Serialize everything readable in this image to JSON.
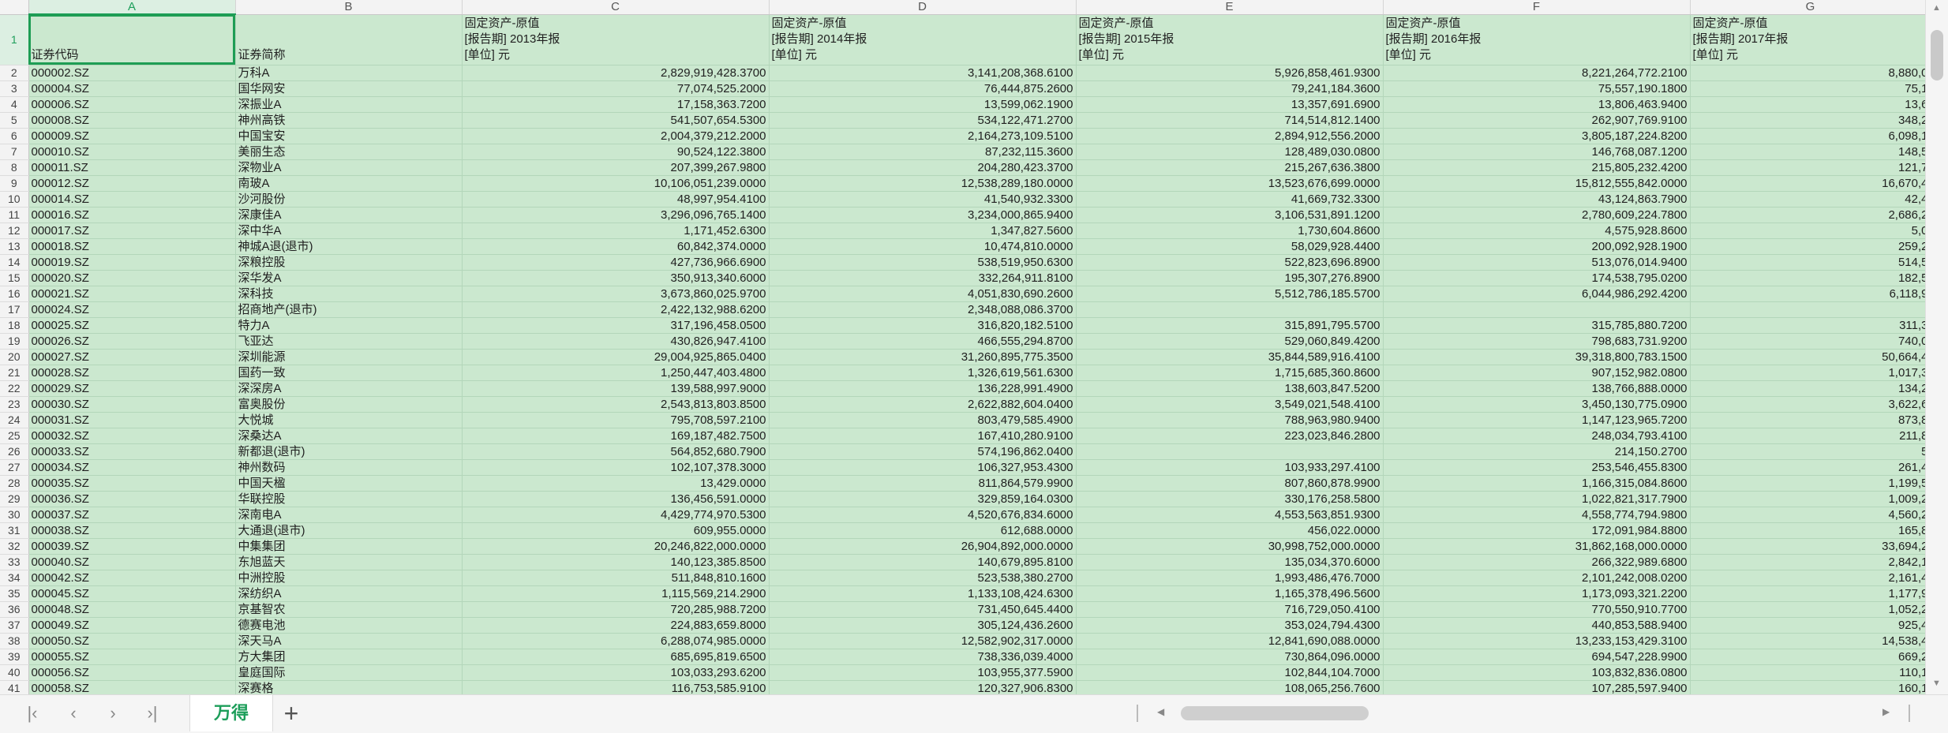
{
  "columns": [
    "A",
    "B",
    "C",
    "D",
    "E",
    "F",
    "G"
  ],
  "header_row": {
    "row": "1",
    "cells": [
      "证券代码",
      "证券简称",
      "固定资产-原值\n[报告期] 2013年报\n[单位] 元",
      "固定资产-原值\n[报告期] 2014年报\n[单位] 元",
      "固定资产-原值\n[报告期] 2015年报\n[单位] 元",
      "固定资产-原值\n[报告期] 2016年报\n[单位] 元",
      "固定资产-原值\n[报告期] 2017年报\n[单位] 元"
    ]
  },
  "rows": [
    {
      "r": "2",
      "c": [
        "000002.SZ",
        "万科A",
        "2,829,919,428.3700",
        "3,141,208,368.6100",
        "5,926,858,461.9300",
        "8,221,264,772.2100",
        "8,880,0"
      ]
    },
    {
      "r": "3",
      "c": [
        "000004.SZ",
        "国华网安",
        "77,074,525.2000",
        "76,444,875.2600",
        "79,241,184.3600",
        "75,557,190.1800",
        "75,1"
      ]
    },
    {
      "r": "4",
      "c": [
        "000006.SZ",
        "深振业A",
        "17,158,363.7200",
        "13,599,062.1900",
        "13,357,691.6900",
        "13,806,463.9400",
        "13,6"
      ]
    },
    {
      "r": "5",
      "c": [
        "000008.SZ",
        "神州高铁",
        "541,507,654.5300",
        "534,122,471.2700",
        "714,514,812.1400",
        "262,907,769.9100",
        "348,2"
      ]
    },
    {
      "r": "6",
      "c": [
        "000009.SZ",
        "中国宝安",
        "2,004,379,212.2000",
        "2,164,273,109.5100",
        "2,894,912,556.2000",
        "3,805,187,224.8200",
        "6,098,1"
      ]
    },
    {
      "r": "7",
      "c": [
        "000010.SZ",
        "美丽生态",
        "90,524,122.3800",
        "87,232,115.3600",
        "128,489,030.0800",
        "146,768,087.1200",
        "148,5"
      ]
    },
    {
      "r": "8",
      "c": [
        "000011.SZ",
        "深物业A",
        "207,399,267.9800",
        "204,280,423.3700",
        "215,267,636.3800",
        "215,805,232.4200",
        "121,7"
      ]
    },
    {
      "r": "9",
      "c": [
        "000012.SZ",
        "南玻A",
        "10,106,051,239.0000",
        "12,538,289,180.0000",
        "13,523,676,699.0000",
        "15,812,555,842.0000",
        "16,670,4"
      ]
    },
    {
      "r": "10",
      "c": [
        "000014.SZ",
        "沙河股份",
        "48,997,954.4100",
        "41,540,932.3300",
        "41,669,732.3300",
        "43,124,863.7900",
        "42,4"
      ]
    },
    {
      "r": "11",
      "c": [
        "000016.SZ",
        "深康佳A",
        "3,296,096,765.1400",
        "3,234,000,865.9400",
        "3,106,531,891.1200",
        "2,780,609,224.7800",
        "2,686,2"
      ]
    },
    {
      "r": "12",
      "c": [
        "000017.SZ",
        "深中华A",
        "1,171,452.6300",
        "1,347,827.5600",
        "1,730,604.8600",
        "4,575,928.8600",
        "5,0"
      ]
    },
    {
      "r": "13",
      "c": [
        "000018.SZ",
        "神城A退(退市)",
        "60,842,374.0000",
        "10,474,810.0000",
        "58,029,928.4400",
        "200,092,928.1900",
        "259,2"
      ]
    },
    {
      "r": "14",
      "c": [
        "000019.SZ",
        "深粮控股",
        "427,736,966.6900",
        "538,519,950.6300",
        "522,823,696.8900",
        "513,076,014.9400",
        "514,5"
      ]
    },
    {
      "r": "15",
      "c": [
        "000020.SZ",
        "深华发A",
        "350,913,340.6000",
        "332,264,911.8100",
        "195,307,276.8900",
        "174,538,795.0200",
        "182,5"
      ]
    },
    {
      "r": "16",
      "c": [
        "000021.SZ",
        "深科技",
        "3,673,860,025.9700",
        "4,051,830,690.2600",
        "5,512,786,185.5700",
        "6,044,986,292.4200",
        "6,118,9"
      ]
    },
    {
      "r": "17",
      "c": [
        "000024.SZ",
        "招商地产(退市)",
        "2,422,132,988.6200",
        "2,348,088,086.3700",
        "",
        "",
        ""
      ]
    },
    {
      "r": "18",
      "c": [
        "000025.SZ",
        "特力A",
        "317,196,458.0500",
        "316,820,182.5100",
        "315,891,795.5700",
        "315,785,880.7200",
        "311,3"
      ]
    },
    {
      "r": "19",
      "c": [
        "000026.SZ",
        "飞亚达",
        "430,826,947.4100",
        "466,555,294.8700",
        "529,060,849.4200",
        "798,683,731.9200",
        "740,0"
      ]
    },
    {
      "r": "20",
      "c": [
        "000027.SZ",
        "深圳能源",
        "29,004,925,865.0400",
        "31,260,895,775.3500",
        "35,844,589,916.4100",
        "39,318,800,783.1500",
        "50,664,4"
      ]
    },
    {
      "r": "21",
      "c": [
        "000028.SZ",
        "国药一致",
        "1,250,447,403.4800",
        "1,326,619,561.6300",
        "1,715,685,360.8600",
        "907,152,982.0800",
        "1,017,3"
      ]
    },
    {
      "r": "22",
      "c": [
        "000029.SZ",
        "深深房A",
        "139,588,997.9000",
        "136,228,991.4900",
        "138,603,847.5200",
        "138,766,888.0000",
        "134,2"
      ]
    },
    {
      "r": "23",
      "c": [
        "000030.SZ",
        "富奥股份",
        "2,543,813,803.8500",
        "2,622,882,604.0400",
        "3,549,021,548.4100",
        "3,450,130,775.0900",
        "3,622,6"
      ]
    },
    {
      "r": "24",
      "c": [
        "000031.SZ",
        "大悦城",
        "795,708,597.2100",
        "803,479,585.4900",
        "788,963,980.9400",
        "1,147,123,965.7200",
        "873,8"
      ]
    },
    {
      "r": "25",
      "c": [
        "000032.SZ",
        "深桑达A",
        "169,187,482.7500",
        "167,410,280.9100",
        "223,023,846.2800",
        "248,034,793.4100",
        "211,8"
      ]
    },
    {
      "r": "26",
      "c": [
        "000033.SZ",
        "新都退(退市)",
        "564,852,680.7900",
        "574,196,862.0400",
        "",
        "214,150.2700",
        "5"
      ]
    },
    {
      "r": "27",
      "c": [
        "000034.SZ",
        "神州数码",
        "102,107,378.3000",
        "106,327,953.4300",
        "103,933,297.4100",
        "253,546,455.8300",
        "261,4"
      ]
    },
    {
      "r": "28",
      "c": [
        "000035.SZ",
        "中国天楹",
        "13,429.0000",
        "811,864,579.9900",
        "807,860,878.9900",
        "1,166,315,084.8600",
        "1,199,5"
      ]
    },
    {
      "r": "29",
      "c": [
        "000036.SZ",
        "华联控股",
        "136,456,591.0000",
        "329,859,164.0300",
        "330,176,258.5800",
        "1,022,821,317.7900",
        "1,009,2"
      ]
    },
    {
      "r": "30",
      "c": [
        "000037.SZ",
        "深南电A",
        "4,429,774,970.5300",
        "4,520,676,834.6000",
        "4,553,563,851.9300",
        "4,558,774,794.9800",
        "4,560,2"
      ]
    },
    {
      "r": "31",
      "c": [
        "000038.SZ",
        "大通退(退市)",
        "609,955.0000",
        "612,688.0000",
        "456,022.0000",
        "172,091,984.8800",
        "165,8"
      ]
    },
    {
      "r": "32",
      "c": [
        "000039.SZ",
        "中集集团",
        "20,246,822,000.0000",
        "26,904,892,000.0000",
        "30,998,752,000.0000",
        "31,862,168,000.0000",
        "33,694,2"
      ]
    },
    {
      "r": "33",
      "c": [
        "000040.SZ",
        "东旭蓝天",
        "140,123,385.8500",
        "140,679,895.8100",
        "135,034,370.6000",
        "266,322,989.6800",
        "2,842,1"
      ]
    },
    {
      "r": "34",
      "c": [
        "000042.SZ",
        "中洲控股",
        "511,848,810.1600",
        "523,538,380.2700",
        "1,993,486,476.7000",
        "2,101,242,008.0200",
        "2,161,4"
      ]
    },
    {
      "r": "35",
      "c": [
        "000045.SZ",
        "深纺织A",
        "1,115,569,214.2900",
        "1,133,108,424.6300",
        "1,165,378,496.5600",
        "1,173,093,321.2200",
        "1,177,9"
      ]
    },
    {
      "r": "36",
      "c": [
        "000048.SZ",
        "京基智农",
        "720,285,988.7200",
        "731,450,645.4400",
        "716,729,050.4100",
        "770,550,910.7700",
        "1,052,2"
      ]
    },
    {
      "r": "37",
      "c": [
        "000049.SZ",
        "德赛电池",
        "224,883,659.8000",
        "305,124,436.2600",
        "353,024,794.4300",
        "440,853,588.9400",
        "925,4"
      ]
    },
    {
      "r": "38",
      "c": [
        "000050.SZ",
        "深天马A",
        "6,288,074,985.0000",
        "12,582,902,317.0000",
        "12,841,690,088.0000",
        "13,233,153,429.3100",
        "14,538,4"
      ]
    },
    {
      "r": "39",
      "c": [
        "000055.SZ",
        "方大集团",
        "685,695,819.6500",
        "738,336,039.4000",
        "730,864,096.0000",
        "694,547,228.9900",
        "669,2"
      ]
    },
    {
      "r": "40",
      "c": [
        "000056.SZ",
        "皇庭国际",
        "103,033,293.6200",
        "103,955,377.5900",
        "102,844,104.7000",
        "103,832,836.0800",
        "110,1"
      ]
    },
    {
      "r": "41",
      "c": [
        "000058.SZ",
        "深赛格",
        "116,753,585.9100",
        "120,327,906.8300",
        "108,065,256.7600",
        "107,285,597.9400",
        "160,1"
      ]
    }
  ],
  "sheet_tab": "万得",
  "colors": {
    "cell_fill": "#cbe8cf",
    "accent": "#1d9e5a",
    "header_bg": "#f3f3f3"
  }
}
